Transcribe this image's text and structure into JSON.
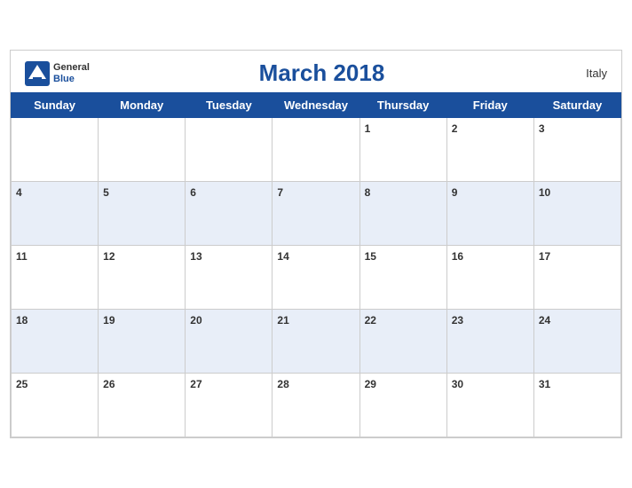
{
  "header": {
    "logo_general": "General",
    "logo_blue": "Blue",
    "title": "March 2018",
    "country": "Italy"
  },
  "weekdays": [
    "Sunday",
    "Monday",
    "Tuesday",
    "Wednesday",
    "Thursday",
    "Friday",
    "Saturday"
  ],
  "weeks": [
    [
      null,
      null,
      null,
      null,
      1,
      2,
      3
    ],
    [
      4,
      5,
      6,
      7,
      8,
      9,
      10
    ],
    [
      11,
      12,
      13,
      14,
      15,
      16,
      17
    ],
    [
      18,
      19,
      20,
      21,
      22,
      23,
      24
    ],
    [
      25,
      26,
      27,
      28,
      29,
      30,
      31
    ]
  ]
}
